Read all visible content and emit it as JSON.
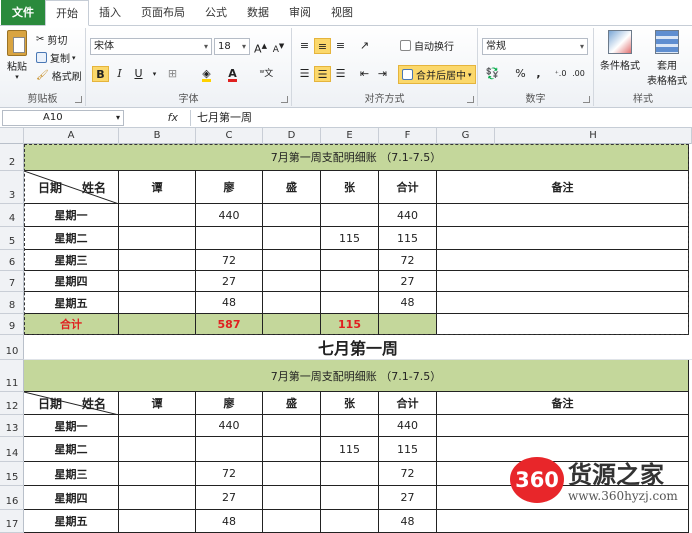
{
  "tabs": [
    "文件",
    "开始",
    "插入",
    "页面布局",
    "公式",
    "数据",
    "审阅",
    "视图"
  ],
  "ribbon": {
    "clipboard": {
      "paste": "粘贴",
      "cut": "剪切",
      "copy": "复制",
      "format_painter": "格式刷",
      "label": "剪贴板"
    },
    "font": {
      "name": "宋体",
      "size": "18",
      "label": "字体"
    },
    "alignment": {
      "wrap": "自动换行",
      "merge": "合并后居中",
      "label": "对齐方式"
    },
    "number": {
      "format": "常规",
      "label": "数字"
    },
    "styles": {
      "conditional": "条件格式",
      "table_line1": "套用",
      "table_line2": "表格格式",
      "label": "样式"
    }
  },
  "formula_bar": {
    "name_box": "A10",
    "fx": "fx",
    "content": "七月第一周"
  },
  "columns": [
    "A",
    "B",
    "C",
    "D",
    "E",
    "F",
    "G",
    "H"
  ],
  "rows": [
    "2",
    "3",
    "4",
    "5",
    "6",
    "7",
    "8",
    "9",
    "10",
    "11",
    "12",
    "13",
    "14",
    "15",
    "16",
    "17"
  ],
  "table1": {
    "title": "7月第一周支配明细账 （7.1-7.5）",
    "header_a_left": "日期",
    "header_a_right": "姓名",
    "headers": [
      "谭",
      "廖",
      "盛",
      "张",
      "合计",
      "备注"
    ],
    "rows": [
      {
        "day": "星期一",
        "tan": "",
        "liao": "440",
        "sheng": "",
        "zhang": "",
        "total": "440"
      },
      {
        "day": "星期二",
        "tan": "",
        "liao": "",
        "sheng": "",
        "zhang": "115",
        "total": "115"
      },
      {
        "day": "星期三",
        "tan": "",
        "liao": "72",
        "sheng": "",
        "zhang": "",
        "total": "72"
      },
      {
        "day": "星期四",
        "tan": "",
        "liao": "27",
        "sheng": "",
        "zhang": "",
        "total": "27"
      },
      {
        "day": "星期五",
        "tan": "",
        "liao": "48",
        "sheng": "",
        "zhang": "",
        "total": "48"
      }
    ],
    "sum_label": "合计",
    "sum_liao": "587",
    "sum_zhang": "115"
  },
  "heading": "七月第一周",
  "table2": {
    "title": "7月第一周支配明细账 （7.1-7.5）",
    "header_a_left": "日期",
    "header_a_right": "姓名",
    "headers": [
      "谭",
      "廖",
      "盛",
      "张",
      "合计",
      "备注"
    ],
    "rows": [
      {
        "day": "星期一",
        "tan": "",
        "liao": "440",
        "sheng": "",
        "zhang": "",
        "total": "440"
      },
      {
        "day": "星期二",
        "tan": "",
        "liao": "",
        "sheng": "",
        "zhang": "115",
        "total": "115"
      },
      {
        "day": "星期三",
        "tan": "",
        "liao": "72",
        "sheng": "",
        "zhang": "",
        "total": "72"
      },
      {
        "day": "星期四",
        "tan": "",
        "liao": "27",
        "sheng": "",
        "zhang": "",
        "total": "27"
      },
      {
        "day": "星期五",
        "tan": "",
        "liao": "48",
        "sheng": "",
        "zhang": "",
        "total": "48"
      }
    ]
  },
  "watermark": {
    "logo": "360",
    "name": "货源之家",
    "url": "www.360hyzj.com"
  },
  "colors": {
    "header_green": "#c4d79b",
    "sum_red": "#e02020",
    "file_tab": "#2a8a3c",
    "logo_red": "#e8262a"
  }
}
